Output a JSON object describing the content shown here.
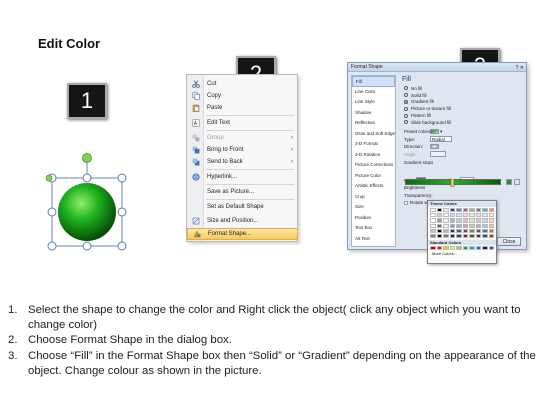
{
  "page_title": "Edit Color",
  "steps": {
    "one": "1",
    "two": "2",
    "three": "3"
  },
  "context_menu": {
    "items": [
      {
        "label": "Cut",
        "icon": "scissors-icon",
        "disabled": false,
        "submenu": false
      },
      {
        "label": "Copy",
        "icon": "copy-icon",
        "disabled": false,
        "submenu": false
      },
      {
        "label": "Paste",
        "icon": "paste-icon",
        "disabled": false,
        "submenu": false
      },
      {
        "label": "Edit Text",
        "icon": "edit-text-icon",
        "disabled": false,
        "submenu": false
      },
      {
        "label": "Group",
        "icon": "group-icon",
        "disabled": true,
        "submenu": true
      },
      {
        "label": "Bring to Front",
        "icon": "bring-front-icon",
        "disabled": false,
        "submenu": true
      },
      {
        "label": "Send to Back",
        "icon": "send-back-icon",
        "disabled": false,
        "submenu": true
      },
      {
        "label": "Hyperlink...",
        "icon": "hyperlink-icon",
        "disabled": false,
        "submenu": false
      },
      {
        "label": "Save as Picture...",
        "icon": "",
        "disabled": false,
        "submenu": false
      },
      {
        "label": "Set as Default Shape",
        "icon": "",
        "disabled": false,
        "submenu": false
      },
      {
        "label": "Size and Position...",
        "icon": "size-icon",
        "disabled": false,
        "submenu": false
      },
      {
        "label": "Format Shape...",
        "icon": "format-shape-icon",
        "disabled": false,
        "submenu": false
      }
    ],
    "highlighted": "Format Shape..."
  },
  "dialog": {
    "title": "Format Shape",
    "categories": [
      "Fill",
      "Line Color",
      "Line Style",
      "Shadow",
      "Reflection",
      "Glow and Soft Edges",
      "3-D Format",
      "3-D Rotation",
      "Picture Corrections",
      "Picture Color",
      "Artistic Effects",
      "Crop",
      "Size",
      "Position",
      "Text Box",
      "Alt Text"
    ],
    "selected_category": "Fill",
    "pane_heading": "Fill",
    "fill_options": [
      "No fill",
      "Solid fill",
      "Gradient fill",
      "Picture or texture fill",
      "Pattern fill",
      "Slide background fill"
    ],
    "selected_fill": "Gradient fill",
    "preset_colors_label": "Preset colors:",
    "type_label": "Type:",
    "type_value": "Radial",
    "direction_label": "Direction:",
    "angle_label": "Angle:",
    "gradient_stops_label": "Gradient stops",
    "color_label": "Color",
    "position_label": "Position:",
    "position_value": "40%",
    "brightness_label": "Brightness",
    "transparency_label": "Transparency:",
    "rotate_label": "Rotate with shape",
    "close_label": "Close",
    "color_picker": {
      "theme_header": "Theme Colors",
      "standard_header": "Standard Colors",
      "more_colors": "More Colors...",
      "theme_colors": [
        "#ffffff",
        "#000000",
        "#eeece1",
        "#1f497d",
        "#4f81bd",
        "#c0504d",
        "#9bbb59",
        "#8064a2",
        "#4bacc6",
        "#f79646"
      ],
      "standard_colors": [
        "#c00000",
        "#ff0000",
        "#ffc000",
        "#ffff00",
        "#92d050",
        "#00b050",
        "#00b0f0",
        "#0070c0",
        "#002060",
        "#7030a0"
      ]
    }
  },
  "instructions": [
    {
      "num": "1.",
      "text": "Select the shape to change the color and Right click the object( click any object which you want to change color)"
    },
    {
      "num": "2.",
      "text": "Choose Format Shape in the dialog box."
    },
    {
      "num": "3.",
      "text": "Choose “Fill” in the Format Shape box then “Solid” or “Gradient” depending on the appearance of the object. Change colour as shown in the picture."
    }
  ],
  "colors": {
    "shape_fill": "#1fa31f",
    "handle_stroke": "#5a7bb0",
    "rotate_handle": "#7fd34f",
    "badge_bg": "#151515",
    "menu_highlight": "#f7c95c"
  }
}
